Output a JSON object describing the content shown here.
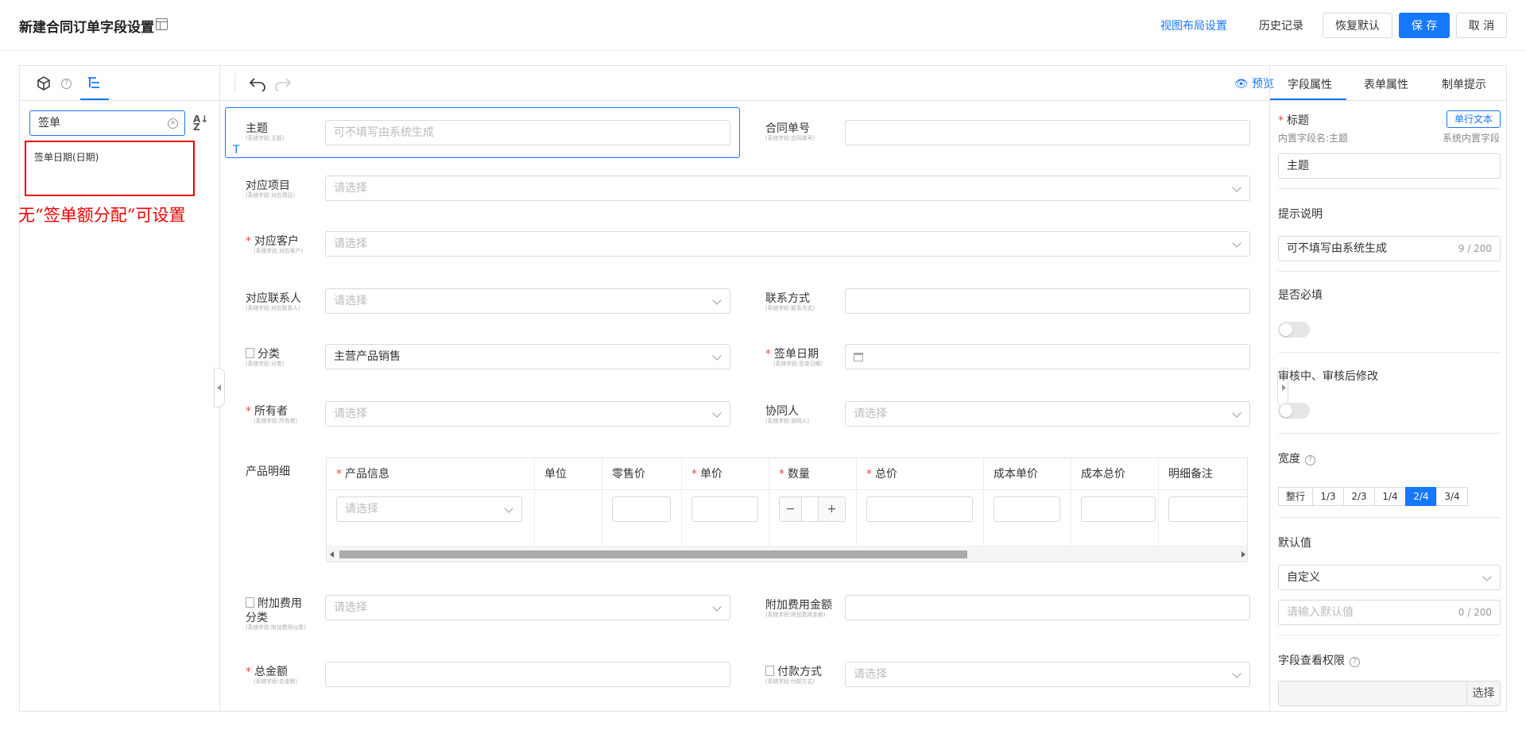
{
  "header": {
    "title": "新建合同订单字段设置",
    "view_layout_link": "视图布局设置",
    "history_link": "历史记录",
    "restore_default": "恢复默认",
    "save": "保 存",
    "cancel": "取 消"
  },
  "left_panel": {
    "search_value": "签单",
    "results": [
      "签单日期(日期)"
    ],
    "annotation": "无“签单额分配”可设置"
  },
  "center": {
    "preview_label": "预览",
    "fields": {
      "subject": {
        "label": "主题",
        "sub": "(系统字段:主题)",
        "placeholder": "可不填写由系统生成"
      },
      "contract_no": {
        "label": "合同单号",
        "sub": "(系统字段:合同单号)",
        "value": ""
      },
      "project": {
        "label": "对应项目",
        "sub": "(系统字段:对应项目)",
        "placeholder": "请选择"
      },
      "customer": {
        "label": "对应客户",
        "sub": "(系统字段:对应客户)",
        "placeholder": "请选择",
        "required": "*"
      },
      "contact": {
        "label": "对应联系人",
        "sub": "(系统字段:对应联系人)",
        "placeholder": "请选择"
      },
      "contact_info": {
        "label": "联系方式",
        "sub": "(系统字段:联系方式)",
        "value": ""
      },
      "category": {
        "label": "分类",
        "sub": "(系统字段:分类)",
        "value": "主营产品销售"
      },
      "sign_date": {
        "label": "签单日期",
        "sub": "(系统字段:签单日期)",
        "required": "*"
      },
      "owner": {
        "label": "所有者",
        "sub": "(系统字段:所有者)",
        "placeholder": "请选择",
        "required": "*"
      },
      "collaborator": {
        "label": "协同人",
        "sub": "(系统字段:协同人)",
        "placeholder": "请选择"
      },
      "product_detail": {
        "label": "产品明细"
      },
      "extra_fee_cat": {
        "label": "附加费用",
        "label2": "分类",
        "sub": "(系统字段:附加费用分类)",
        "placeholder": "请选择"
      },
      "extra_fee_amt": {
        "label": "附加费用金额",
        "sub": "(系统字段:附加费用金额)",
        "value": ""
      },
      "total": {
        "label": "总金额",
        "sub": "(系统字段:总金额)",
        "required": "*"
      },
      "payment": {
        "label": "付款方式",
        "sub": "(系统字段:付款方式)",
        "placeholder": "请选择"
      }
    },
    "product_table": {
      "columns": [
        {
          "label": "产品信息",
          "required": "*"
        },
        {
          "label": "单位"
        },
        {
          "label": "零售价"
        },
        {
          "label": "单价",
          "required": "*"
        },
        {
          "label": "数量",
          "required": "*"
        },
        {
          "label": "总价",
          "required": "*"
        },
        {
          "label": "成本单价"
        },
        {
          "label": "成本总价"
        },
        {
          "label": "明细备注"
        }
      ],
      "product_placeholder": "请选择",
      "minus": "−",
      "plus": "+"
    }
  },
  "right_panel": {
    "tabs": [
      "字段属性",
      "表单属性",
      "制单提示"
    ],
    "title_label": "标题",
    "title_required": "*",
    "field_type_badge": "单行文本",
    "builtin_name": "内置字段名:主题",
    "builtin_flag": "系统内置字段",
    "title_value": "主题",
    "hint_label": "提示说明",
    "hint_value": "可不填写由系统生成",
    "hint_count": "9 / 200",
    "required_label": "是否必填",
    "required_on": false,
    "audit_label": "审核中、审核后修改",
    "audit_on": false,
    "width_label": "宽度",
    "width_options": [
      "整行",
      "1/3",
      "2/3",
      "1/4",
      "2/4",
      "3/4"
    ],
    "width_selected": "2/4",
    "default_label": "默认值",
    "default_mode": "自定义",
    "default_placeholder": "请输入默认值",
    "default_count": "0 / 200",
    "permission_label": "字段查看权限",
    "permission_button": "选择",
    "help_icon": "?"
  },
  "colors": {
    "accent": "#1677ff",
    "required": "#f0483e",
    "annotation": "#e00000"
  }
}
